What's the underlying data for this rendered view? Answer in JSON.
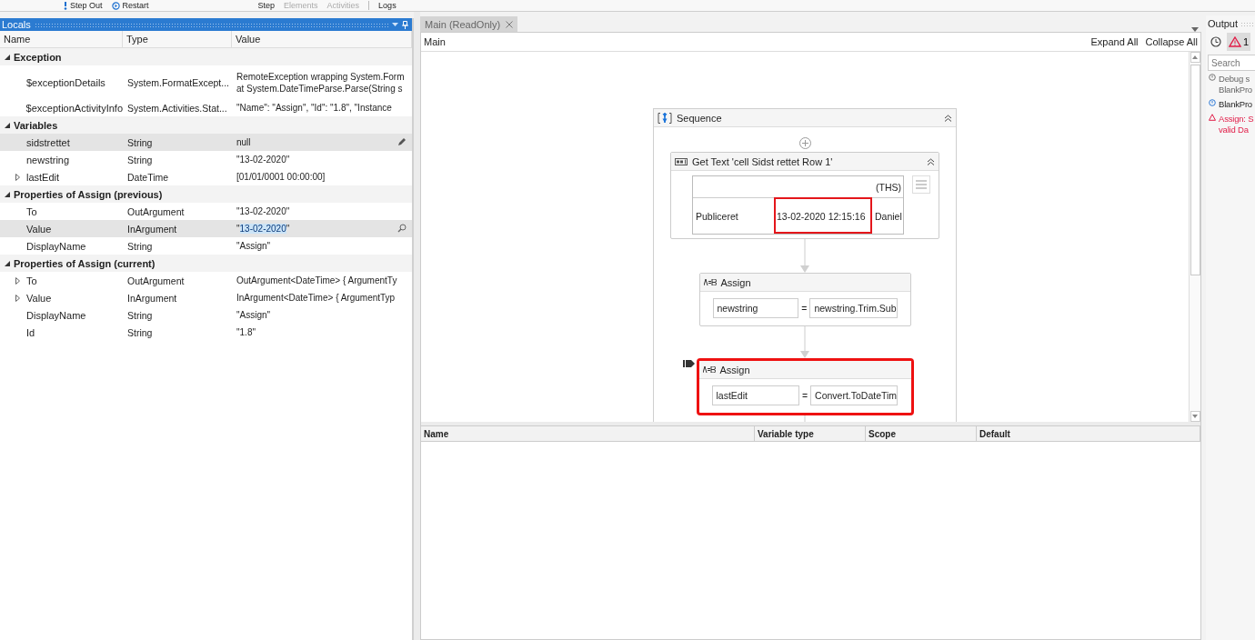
{
  "toolbar": {
    "debug_actions": [
      {
        "label": "Step Out",
        "kind": "step-out",
        "disabled": false
      },
      {
        "label": "Restart",
        "kind": "restart",
        "disabled": false
      }
    ],
    "ribbon_actions": [
      {
        "label": "Step",
        "disabled": false
      },
      {
        "label": "Elements",
        "disabled": true
      },
      {
        "label": "Activities",
        "disabled": true
      },
      {
        "label": "Logs",
        "disabled": false
      }
    ]
  },
  "locals": {
    "title": "Locals",
    "columns": [
      "Name",
      "Type",
      "Value"
    ],
    "groups": [
      {
        "label": "Exception",
        "expanded": true,
        "rows": [
          {
            "name": "$exceptionDetails",
            "type": "System.FormatExcept...",
            "value": "RemoteException wrapping System.Form\nat System.DateTimeParse.Parse(String s",
            "expandable": false,
            "selected": false
          },
          {
            "name": "$exceptionActivityInfo",
            "type": "System.Activities.Stat...",
            "value": "\"Name\": \"Assign\", \"Id\": \"1.8\", \"Instance",
            "expandable": false,
            "selected": false
          }
        ]
      },
      {
        "label": "Variables",
        "expanded": true,
        "rows": [
          {
            "name": "sidstrettet",
            "type": "String",
            "value": "null",
            "expandable": false,
            "selected": true,
            "kind": "editable"
          },
          {
            "name": "newstring",
            "type": "String",
            "value": "\"13-02-2020\"",
            "expandable": false,
            "selected": false
          },
          {
            "name": "lastEdit",
            "type": "DateTime",
            "value": "[01/01/0001 00:00:00]",
            "expandable": true,
            "selected": false
          }
        ]
      },
      {
        "label": "Properties of Assign (previous)",
        "expanded": true,
        "rows": [
          {
            "name": "To",
            "type": "OutArgument",
            "value": "\"13-02-2020\"",
            "expandable": false,
            "selected": false
          },
          {
            "name": "Value",
            "type": "InArgument",
            "value_selection": {
              "before": "\"",
              "selected": "13-02-2020",
              "after": "\""
            },
            "expandable": false,
            "selected": true,
            "kind": "lookup"
          },
          {
            "name": "DisplayName",
            "type": "String",
            "value": "\"Assign\"",
            "expandable": false,
            "selected": false
          }
        ]
      },
      {
        "label": "Properties of Assign (current)",
        "expanded": true,
        "rows": [
          {
            "name": "To",
            "type": "OutArgument",
            "value": "OutArgument<DateTime> { ArgumentTy",
            "expandable": true,
            "selected": false
          },
          {
            "name": "Value",
            "type": "InArgument",
            "value": "InArgument<DateTime> { ArgumentTyp",
            "expandable": true,
            "selected": false
          },
          {
            "name": "DisplayName",
            "type": "String",
            "value": "\"Assign\"",
            "expandable": false,
            "selected": false
          },
          {
            "name": "Id",
            "type": "String",
            "value": "\"1.8\"",
            "expandable": false,
            "selected": false
          }
        ]
      }
    ]
  },
  "designer": {
    "tab": {
      "label": "Main (ReadOnly)",
      "selected": true
    },
    "breadcrumb": "Main",
    "expand_all": "Expand All",
    "collapse_all": "Collapse All",
    "sequence": {
      "title": "Sequence",
      "activities": [
        {
          "kind": "get-text",
          "title": "Get Text 'cell  Sidst rettet Row 1'",
          "preview": [
            [
              {
                "selected": false
              },
              {
                "selected": false
              },
              {
                "text": "(THS)",
                "selected": false
              }
            ],
            [
              {
                "text": "Publiceret",
                "selected": false
              },
              {
                "text": "13-02-2020 12:15:16",
                "selected": true
              },
              {
                "text": "Daniel",
                "selected": false
              }
            ]
          ]
        },
        {
          "kind": "assign",
          "title": "Assign",
          "to": "newstring",
          "operator": "=",
          "value": "newstring.Trim.Sub",
          "error": false
        },
        {
          "kind": "assign",
          "title": "Assign",
          "to": "lastEdit",
          "operator": "=",
          "value": "Convert.ToDateTim",
          "error": true,
          "current": true
        }
      ]
    }
  },
  "variables": {
    "columns": [
      "Name",
      "Variable type",
      "Scope",
      "Default"
    ]
  },
  "output": {
    "title": "Output",
    "filters": [
      {
        "kind": "clock",
        "selected": false
      },
      {
        "kind": "warning",
        "count": "1",
        "selected": true
      }
    ],
    "search_placeholder": "Search",
    "entries": [
      {
        "kind": "info",
        "lines": [
          "Debug s",
          "BlankPro"
        ]
      },
      {
        "kind": "start",
        "lines": [
          "BlankPro"
        ]
      },
      {
        "kind": "error",
        "lines": [
          "Assign: S",
          "valid Da"
        ]
      }
    ]
  }
}
